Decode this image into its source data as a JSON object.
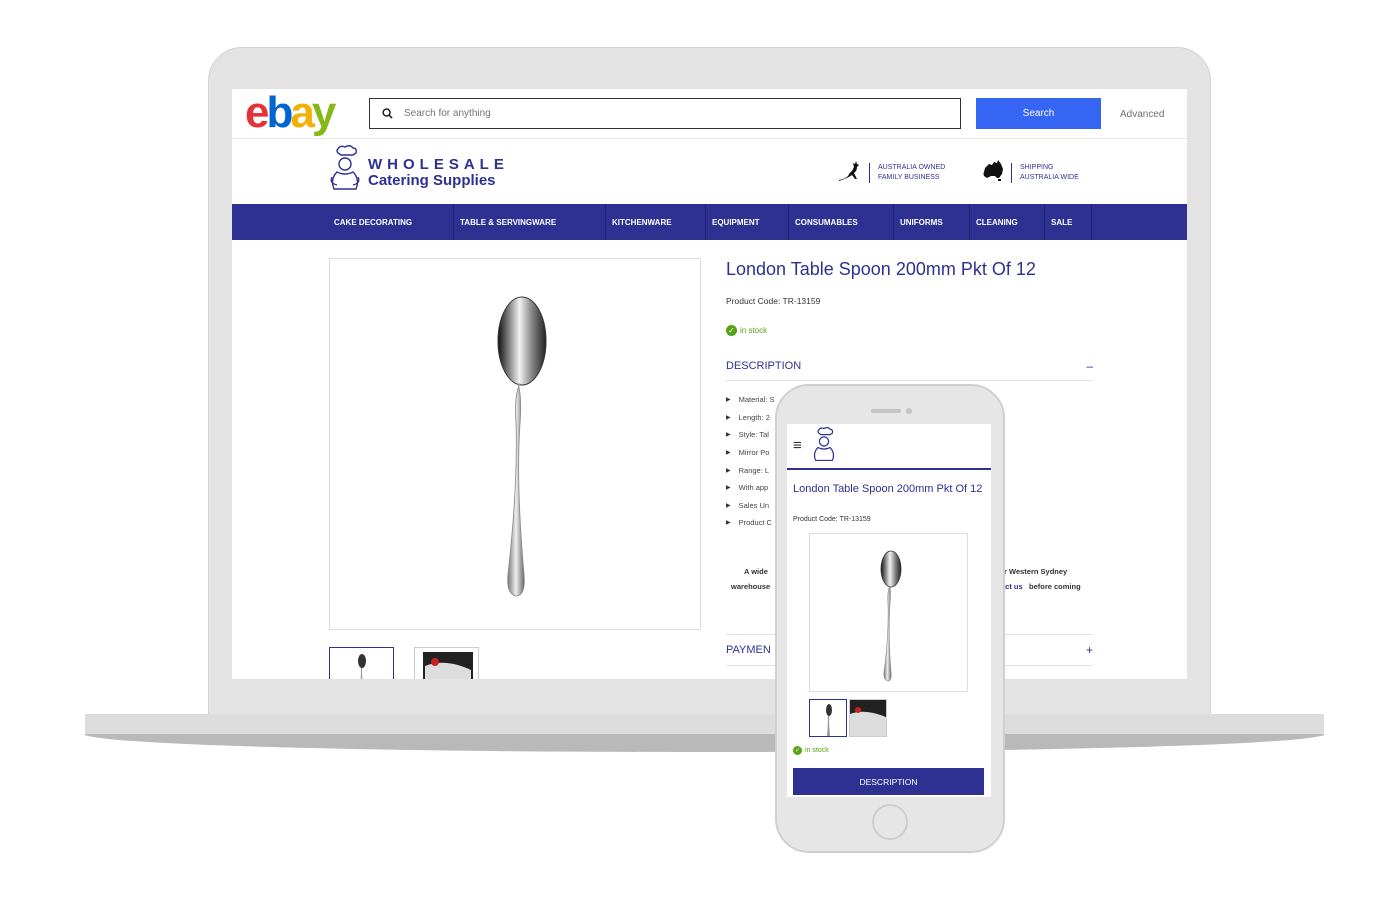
{
  "ebay": {
    "logo": {
      "e": "e",
      "b": "b",
      "a": "a",
      "y": "y"
    },
    "search_placeholder": "Search for anything",
    "search_button": "Search",
    "advanced_link": "Advanced"
  },
  "store": {
    "logo_line1": "WHOLESALE",
    "logo_line2": "Catering Supplies",
    "badge_owned_l1": "AUSTRALIA OWNED",
    "badge_owned_l2": "FAMILY BUSINESS",
    "badge_ship_l1": "SHIPPING",
    "badge_ship_l2": "AUSTRALIA WIDE",
    "brand_color": "#2e3192"
  },
  "nav": {
    "items": [
      "CAKE DECORATING",
      "TABLE & SERVINGWARE",
      "KITCHENWARE",
      "EQUIPMENT",
      "CONSUMABLES",
      "UNIFORMS",
      "CLEANING",
      "SALE"
    ]
  },
  "product": {
    "title": "London Table Spoon 200mm Pkt Of 12",
    "code": "Product Code: TR-13159",
    "stock": "in stock",
    "description_heading": "DESCRIPTION",
    "description_toggle": "–",
    "specs": [
      "Material: S",
      "Length: 2",
      "Style: Tal",
      "Mirror Po",
      "Range: L",
      "With app",
      "Sales Un",
      "Product C"
    ],
    "notice_line1_left": "A wide",
    "notice_line1_right": "r Western Sydney",
    "notice_line2_left": "warehouse",
    "notice_line2_link": "act us",
    "notice_line2_right": "before coming",
    "payment_heading": "PAYMEN",
    "payment_toggle": "+"
  },
  "mobile": {
    "menu_icon": "≡",
    "title": "London Table Spoon 200mm Pkt Of 12",
    "code": "Product Code: TR-13159",
    "stock": "in stock",
    "description_button": "DESCRIPTION"
  }
}
